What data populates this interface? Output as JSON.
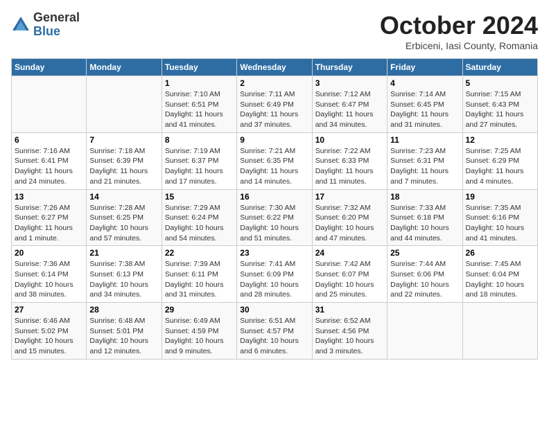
{
  "logo": {
    "general": "General",
    "blue": "Blue"
  },
  "title": "October 2024",
  "location": "Erbiceni, Iasi County, Romania",
  "days_of_week": [
    "Sunday",
    "Monday",
    "Tuesday",
    "Wednesday",
    "Thursday",
    "Friday",
    "Saturday"
  ],
  "weeks": [
    [
      {
        "day": "",
        "info": ""
      },
      {
        "day": "",
        "info": ""
      },
      {
        "day": "1",
        "info": "Sunrise: 7:10 AM\nSunset: 6:51 PM\nDaylight: 11 hours and 41 minutes."
      },
      {
        "day": "2",
        "info": "Sunrise: 7:11 AM\nSunset: 6:49 PM\nDaylight: 11 hours and 37 minutes."
      },
      {
        "day": "3",
        "info": "Sunrise: 7:12 AM\nSunset: 6:47 PM\nDaylight: 11 hours and 34 minutes."
      },
      {
        "day": "4",
        "info": "Sunrise: 7:14 AM\nSunset: 6:45 PM\nDaylight: 11 hours and 31 minutes."
      },
      {
        "day": "5",
        "info": "Sunrise: 7:15 AM\nSunset: 6:43 PM\nDaylight: 11 hours and 27 minutes."
      }
    ],
    [
      {
        "day": "6",
        "info": "Sunrise: 7:16 AM\nSunset: 6:41 PM\nDaylight: 11 hours and 24 minutes."
      },
      {
        "day": "7",
        "info": "Sunrise: 7:18 AM\nSunset: 6:39 PM\nDaylight: 11 hours and 21 minutes."
      },
      {
        "day": "8",
        "info": "Sunrise: 7:19 AM\nSunset: 6:37 PM\nDaylight: 11 hours and 17 minutes."
      },
      {
        "day": "9",
        "info": "Sunrise: 7:21 AM\nSunset: 6:35 PM\nDaylight: 11 hours and 14 minutes."
      },
      {
        "day": "10",
        "info": "Sunrise: 7:22 AM\nSunset: 6:33 PM\nDaylight: 11 hours and 11 minutes."
      },
      {
        "day": "11",
        "info": "Sunrise: 7:23 AM\nSunset: 6:31 PM\nDaylight: 11 hours and 7 minutes."
      },
      {
        "day": "12",
        "info": "Sunrise: 7:25 AM\nSunset: 6:29 PM\nDaylight: 11 hours and 4 minutes."
      }
    ],
    [
      {
        "day": "13",
        "info": "Sunrise: 7:26 AM\nSunset: 6:27 PM\nDaylight: 11 hours and 1 minute."
      },
      {
        "day": "14",
        "info": "Sunrise: 7:28 AM\nSunset: 6:25 PM\nDaylight: 10 hours and 57 minutes."
      },
      {
        "day": "15",
        "info": "Sunrise: 7:29 AM\nSunset: 6:24 PM\nDaylight: 10 hours and 54 minutes."
      },
      {
        "day": "16",
        "info": "Sunrise: 7:30 AM\nSunset: 6:22 PM\nDaylight: 10 hours and 51 minutes."
      },
      {
        "day": "17",
        "info": "Sunrise: 7:32 AM\nSunset: 6:20 PM\nDaylight: 10 hours and 47 minutes."
      },
      {
        "day": "18",
        "info": "Sunrise: 7:33 AM\nSunset: 6:18 PM\nDaylight: 10 hours and 44 minutes."
      },
      {
        "day": "19",
        "info": "Sunrise: 7:35 AM\nSunset: 6:16 PM\nDaylight: 10 hours and 41 minutes."
      }
    ],
    [
      {
        "day": "20",
        "info": "Sunrise: 7:36 AM\nSunset: 6:14 PM\nDaylight: 10 hours and 38 minutes."
      },
      {
        "day": "21",
        "info": "Sunrise: 7:38 AM\nSunset: 6:13 PM\nDaylight: 10 hours and 34 minutes."
      },
      {
        "day": "22",
        "info": "Sunrise: 7:39 AM\nSunset: 6:11 PM\nDaylight: 10 hours and 31 minutes."
      },
      {
        "day": "23",
        "info": "Sunrise: 7:41 AM\nSunset: 6:09 PM\nDaylight: 10 hours and 28 minutes."
      },
      {
        "day": "24",
        "info": "Sunrise: 7:42 AM\nSunset: 6:07 PM\nDaylight: 10 hours and 25 minutes."
      },
      {
        "day": "25",
        "info": "Sunrise: 7:44 AM\nSunset: 6:06 PM\nDaylight: 10 hours and 22 minutes."
      },
      {
        "day": "26",
        "info": "Sunrise: 7:45 AM\nSunset: 6:04 PM\nDaylight: 10 hours and 18 minutes."
      }
    ],
    [
      {
        "day": "27",
        "info": "Sunrise: 6:46 AM\nSunset: 5:02 PM\nDaylight: 10 hours and 15 minutes."
      },
      {
        "day": "28",
        "info": "Sunrise: 6:48 AM\nSunset: 5:01 PM\nDaylight: 10 hours and 12 minutes."
      },
      {
        "day": "29",
        "info": "Sunrise: 6:49 AM\nSunset: 4:59 PM\nDaylight: 10 hours and 9 minutes."
      },
      {
        "day": "30",
        "info": "Sunrise: 6:51 AM\nSunset: 4:57 PM\nDaylight: 10 hours and 6 minutes."
      },
      {
        "day": "31",
        "info": "Sunrise: 6:52 AM\nSunset: 4:56 PM\nDaylight: 10 hours and 3 minutes."
      },
      {
        "day": "",
        "info": ""
      },
      {
        "day": "",
        "info": ""
      }
    ]
  ]
}
